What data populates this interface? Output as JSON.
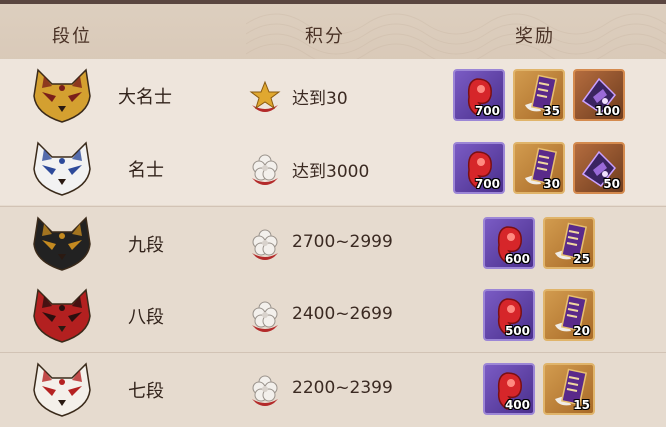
{
  "header": {
    "rank": "段位",
    "score": "积分",
    "reward": "奖励"
  },
  "rows": [
    {
      "name": "大名士",
      "score_icon": "gold-star-medal-icon",
      "score": "达到30",
      "mask_colors": [
        "#d4a030",
        "#7a1f1a"
      ],
      "rewards": [
        {
          "icon": "red-magatama-icon",
          "qty": "700"
        },
        {
          "icon": "skin-ticket-icon",
          "qty": "35"
        },
        {
          "icon": "purple-seal-icon",
          "qty": "100"
        }
      ]
    },
    {
      "name": "名士",
      "score_icon": "white-flower-medal-icon",
      "score": "达到3000",
      "mask_colors": [
        "#f2f2f2",
        "#2d4a9a"
      ],
      "rewards": [
        {
          "icon": "red-magatama-icon",
          "qty": "700"
        },
        {
          "icon": "skin-ticket-icon",
          "qty": "30"
        },
        {
          "icon": "purple-seal-icon",
          "qty": "50"
        }
      ]
    },
    {
      "name": "九段",
      "score_icon": "white-flower-medal-icon",
      "score": "2700~2999",
      "mask_colors": [
        "#222222",
        "#c48a20"
      ],
      "rewards": [
        {
          "icon": "red-magatama-icon",
          "qty": "600"
        },
        {
          "icon": "skin-ticket-icon",
          "qty": "25"
        }
      ]
    },
    {
      "name": "八段",
      "score_icon": "white-flower-medal-icon",
      "score": "2400~2699",
      "mask_colors": [
        "#b32020",
        "#2a0f0f"
      ],
      "rewards": [
        {
          "icon": "red-magatama-icon",
          "qty": "500"
        },
        {
          "icon": "skin-ticket-icon",
          "qty": "20"
        }
      ]
    },
    {
      "name": "七段",
      "score_icon": "white-flower-medal-icon",
      "score": "2200~2399",
      "mask_colors": [
        "#f4f0ea",
        "#b52222"
      ],
      "rewards": [
        {
          "icon": "red-magatama-icon",
          "qty": "400"
        },
        {
          "icon": "skin-ticket-icon",
          "qty": "15"
        }
      ]
    }
  ]
}
